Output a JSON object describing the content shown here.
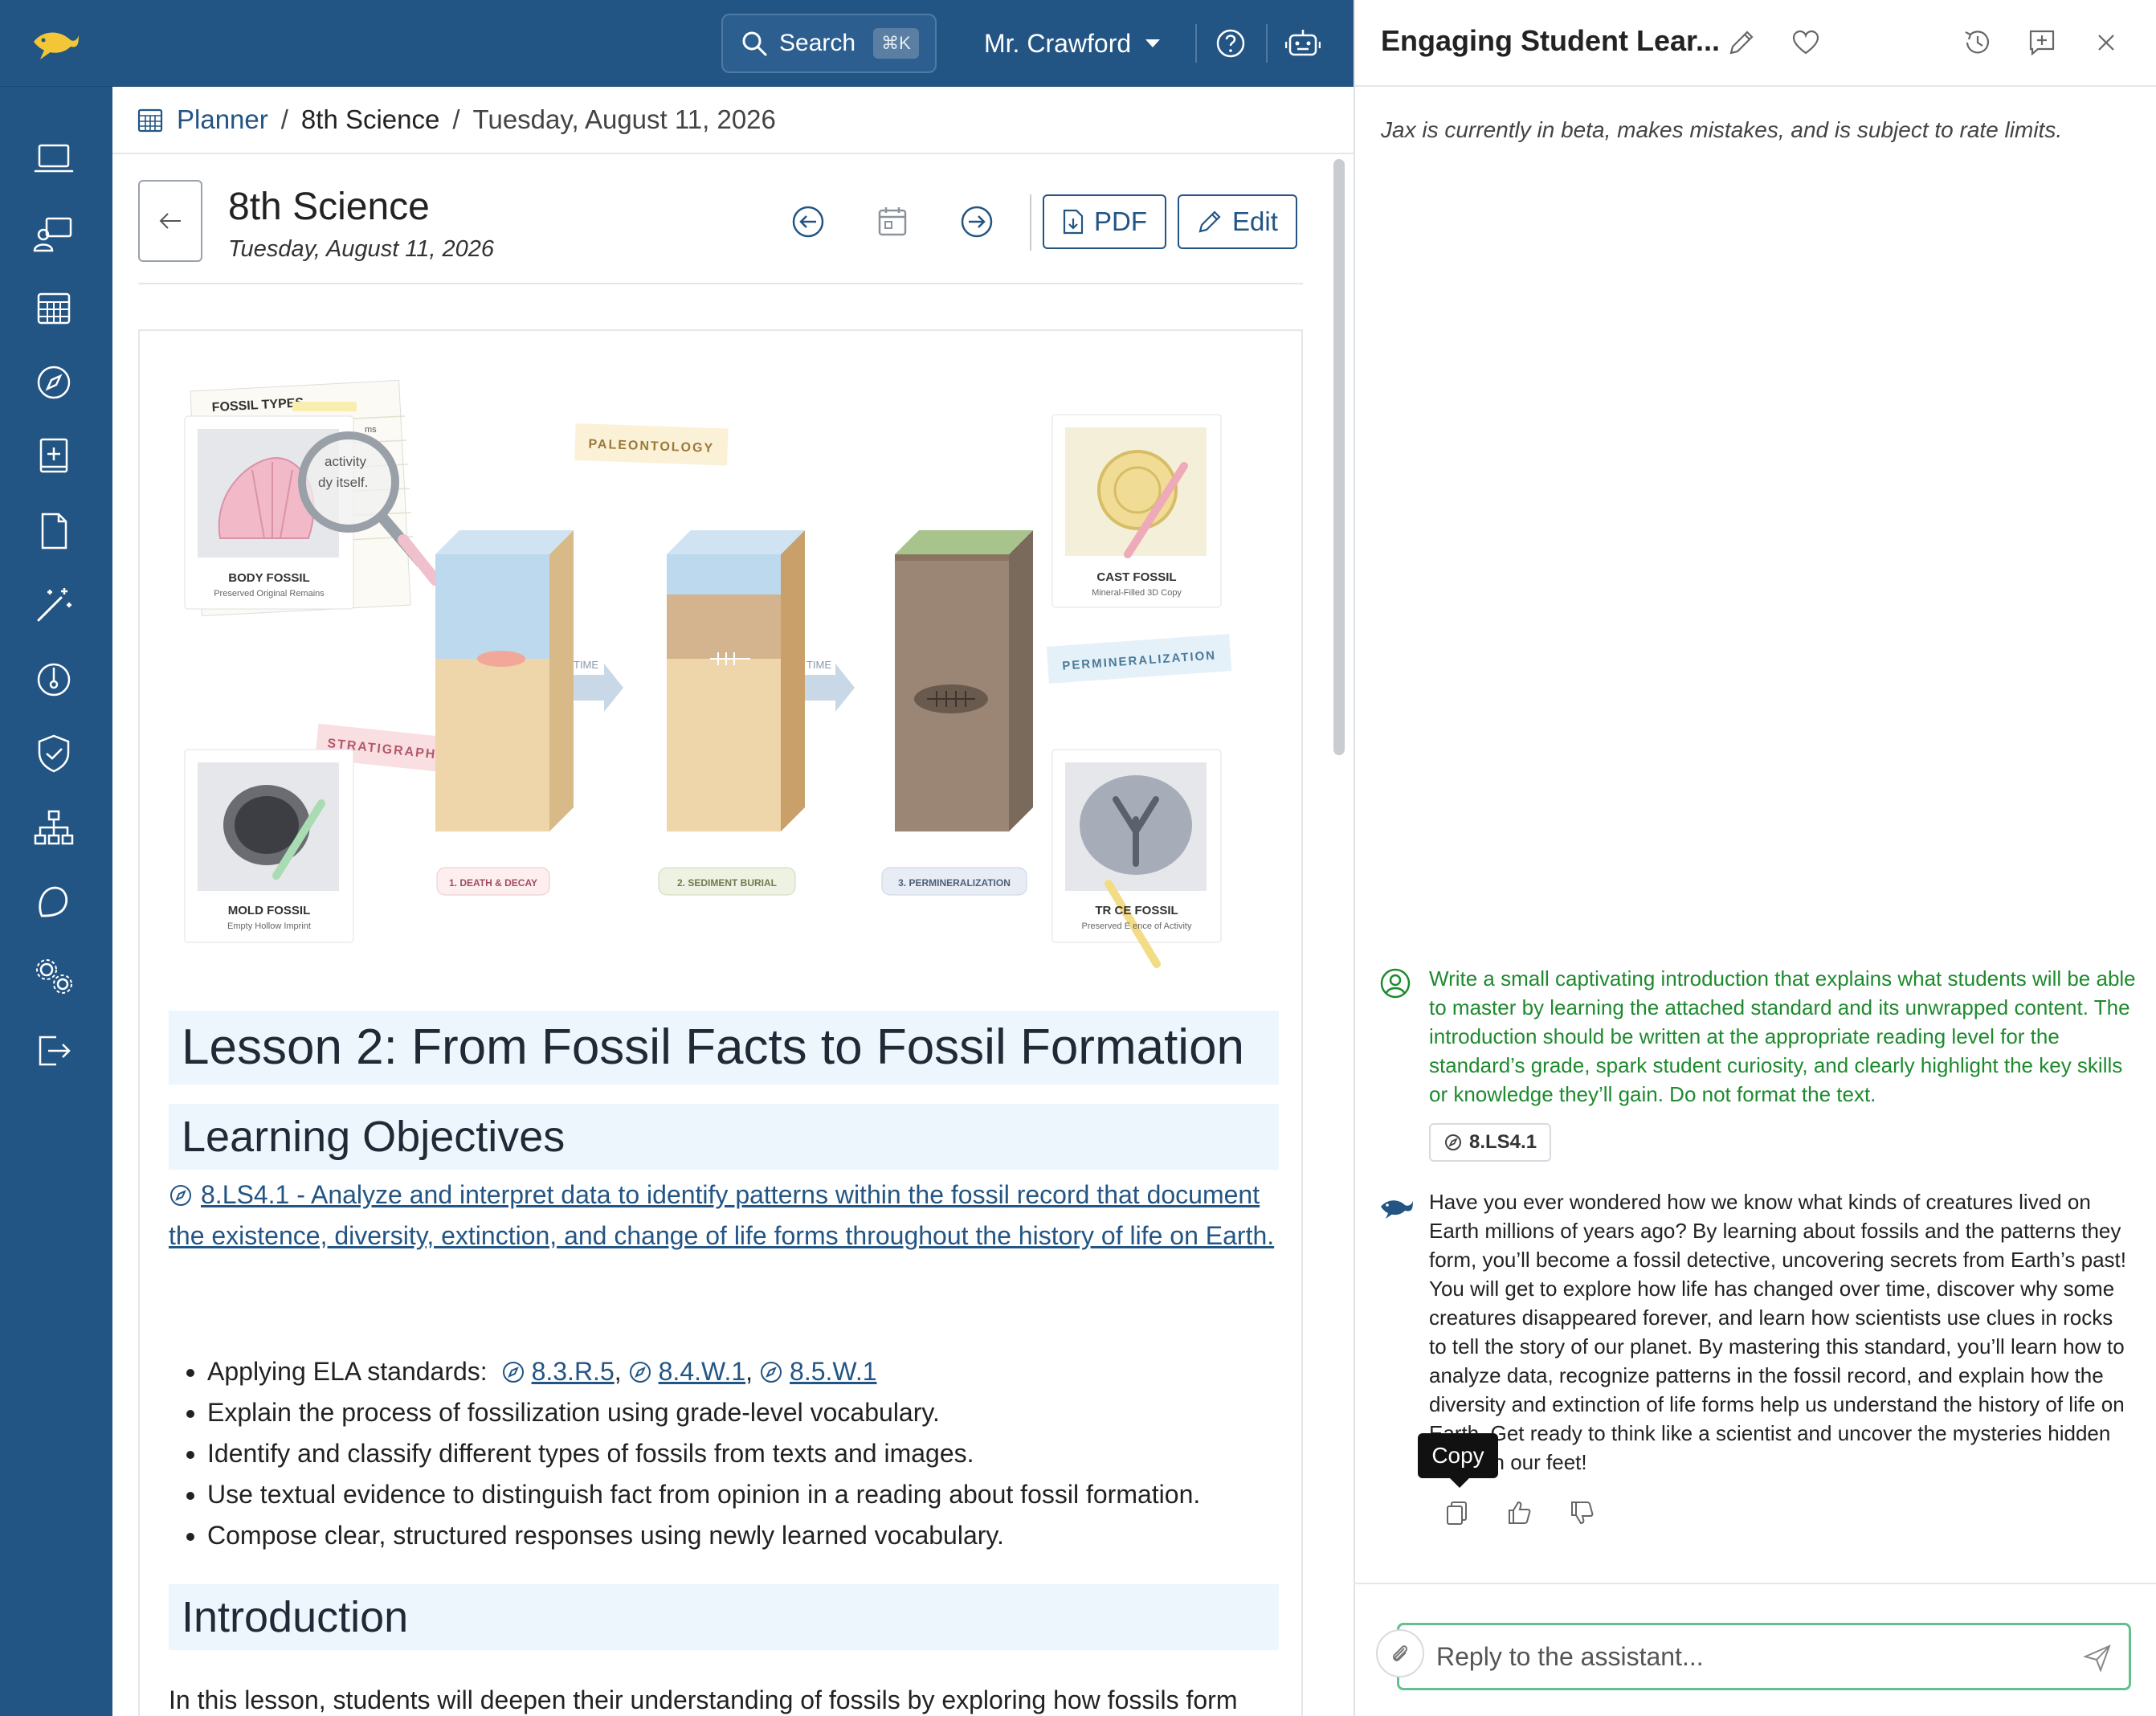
{
  "topbar": {
    "search_label": "Search",
    "search_shortcut": "⌘K",
    "user_name": "Mr. Crawford"
  },
  "sidebar": {
    "items": [
      {
        "icon": "laptop-icon"
      },
      {
        "icon": "teacher-board-icon"
      },
      {
        "icon": "calendar-grid-icon"
      },
      {
        "icon": "compass-icon"
      },
      {
        "icon": "book-plus-icon"
      },
      {
        "icon": "document-icon"
      },
      {
        "icon": "magic-wand-icon"
      },
      {
        "icon": "gauge-icon"
      },
      {
        "icon": "shield-check-icon"
      },
      {
        "icon": "org-chart-icon"
      },
      {
        "icon": "loop-icon"
      },
      {
        "icon": "gears-icon"
      },
      {
        "icon": "logout-icon"
      }
    ]
  },
  "breadcrumb": {
    "planner": "Planner",
    "course": "8th Science",
    "date": "Tuesday, August 11, 2026"
  },
  "page": {
    "title": "8th Science",
    "subtitle": "Tuesday, August 11, 2026",
    "pdf_label": "PDF",
    "edit_label": "Edit"
  },
  "illustration": {
    "fossil_types": "FOSSIL TYPES",
    "note_text_1": "activity",
    "note_text_2": "dy itself.",
    "note_text_3": "ms",
    "paleontology": "PALEONTOLOGY",
    "stratigraphy": "STRATIGRAPHY",
    "permineralization_tag": "PERMINERALIZATION",
    "time_1": "TIME",
    "time_2": "TIME",
    "body_fossil": "BODY FOSSIL",
    "body_fossil_sub": "Preserved Original Remains",
    "cast_fossil": "CAST FOSSIL",
    "cast_fossil_sub": "Mineral-Filled 3D Copy",
    "mold_fossil": "MOLD FOSSIL",
    "mold_fossil_sub": "Empty Hollow Imprint",
    "trace_fossil": "TR  CE FOSSIL",
    "trace_fossil_sub": "Preserved E    ence of Activity",
    "step_1": "1. DEATH & DECAY",
    "step_2": "2. SEDIMENT BURIAL",
    "step_3": "3. PERMINERALIZATION"
  },
  "lesson": {
    "title": "Lesson 2: From Fossil Facts to Fossil Formation",
    "objectives_heading": "Learning Objectives",
    "standard_link": "8.LS4.1 - Analyze and interpret data to identify patterns within the fossil record that document the existence, diversity, extinction, and change of life forms throughout the history of life on Earth.",
    "ela_prefix": "Applying ELA standards:",
    "ela_1": "8.3.R.5",
    "ela_2": "8.4.W.1",
    "ela_3": "8.5.W.1",
    "objectives": [
      "Explain the process of fossilization using grade-level vocabulary.",
      "Identify and classify different types of fossils from texts and images.",
      "Use textual evidence to distinguish fact from opinion in a reading about fossil formation.",
      "Compose clear, structured responses using newly learned vocabulary."
    ],
    "intro_heading": "Introduction",
    "intro_text": "In this lesson, students will deepen their understanding of fossils by exploring how fossils form"
  },
  "chat": {
    "title": "Engaging Student Lear...",
    "disclaimer": "Jax is currently in beta, makes mistakes, and is subject to rate limits.",
    "user_message": "Write a small captivating introduction that explains what students will be able to master by learning the attached standard and its unwrapped content. The introduction should be written at the appropriate reading level for the standard’s grade, spark student curiosity, and clearly highlight the key skills or knowledge they’ll gain. Do not format the text.",
    "standard_chip": "8.LS4.1",
    "assistant_message": "Have you ever wondered how we know what kinds of creatures lived on Earth millions of years ago? By learning about fossils and the patterns they form, you’ll become a fossil detective, uncovering secrets from Earth’s past! You will get to explore how life has changed over time, discover why some creatures disappeared forever, and learn how scientists use clues in rocks to tell the story of our planet. By mastering this standard, you’ll learn how to analyze data, recognize patterns in the fossil record, and explain how the diversity and extinction of life forms help us understand the history of life on Earth. Get ready to think like a scientist and uncover the mysteries hidden beneath our feet!",
    "copy_tooltip": "Copy",
    "reply_placeholder": "Reply to the assistant..."
  },
  "colors": {
    "brand": "#235584",
    "user_text": "#1e8a2e",
    "input_border": "#62c18f",
    "heading_bg": "#eef6fd"
  }
}
